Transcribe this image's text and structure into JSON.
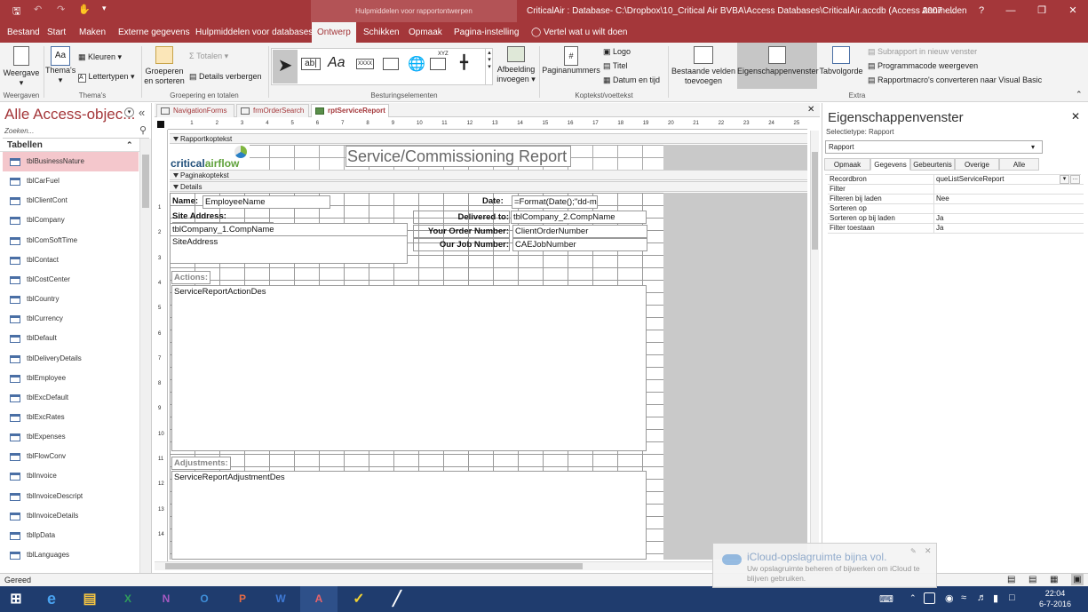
{
  "titlebar": {
    "context_tab": "Hulpmiddelen voor rapportontwerpen",
    "title": "CriticalAir : Database- C:\\Dropbox\\10_Critical Air BVBA\\Access Databases\\CriticalAir.accdb (Access 2007 -...",
    "signin": "Aanmelden",
    "help": "?"
  },
  "tabs": [
    "Bestand",
    "Start",
    "Maken",
    "Externe gegevens",
    "Hulpmiddelen voor databases",
    "Ontwerp",
    "Schikken",
    "Opmaak",
    "Pagina-instelling"
  ],
  "tell_me": "Vertel wat u wilt doen",
  "ribbon": {
    "weergave": "Weergave",
    "themas": "Thema's",
    "kleuren": "Kleuren",
    "lettertypen": "Lettertypen",
    "groeperen": "Groeperen en sorteren",
    "totalen": "Totalen",
    "details_verbergen": "Details verbergen",
    "afbeelding": "Afbeelding invoegen",
    "paginanummers": "Paginanummers",
    "logo": "Logo",
    "titel": "Titel",
    "datum_tijd": "Datum en tijd",
    "bestaande_velden": "Bestaande velden toevoegen",
    "eigenschappenvenster": "Eigenschappenvenster",
    "tabvolgorde": "Tabvolgorde",
    "subrapport": "Subrapport in nieuw venster",
    "programmacode": "Programmacode weergeven",
    "macros_converteren": "Rapportmacro's converteren naar Visual Basic",
    "groups": {
      "weergaven": "Weergaven",
      "themas": "Thema's",
      "groepering": "Groepering en totalen",
      "besturing": "Besturingselementen",
      "koptekst": "Koptekst/voettekst",
      "extra": "Extra"
    }
  },
  "nav": {
    "header": "Alle Access-objec...",
    "search_placeholder": "Zoeken...",
    "section": "Tabellen",
    "items": [
      "tblBusinessNature",
      "tblCarFuel",
      "tblClientCont",
      "tblCompany",
      "tblComSoftTime",
      "tblContact",
      "tblCostCenter",
      "tblCountry",
      "tblCurrency",
      "tblDefault",
      "tblDeliveryDetails",
      "tblEmployee",
      "tblExcDefault",
      "tblExcRates",
      "tblExpenses",
      "tblFlowConv",
      "tblInvoice",
      "tblInvoiceDescript",
      "tblInvoiceDetails",
      "tblIpData",
      "tblLanguages"
    ],
    "selected_index": 0
  },
  "doc_tabs": [
    "NavigationForms",
    "frmOrderSearch",
    "rptServiceReport"
  ],
  "report": {
    "band_header": "Rapportkoptekst",
    "band_page": "Paginakoptekst",
    "band_details": "Details",
    "title": "Service/Commissioning Report",
    "logo_text_1": "critical",
    "logo_text_2": "airflow",
    "name_label": "Name:",
    "name_field": "EmployeeName",
    "date_label": "Date:",
    "date_field": "=Format(Date();\"dd-m",
    "site_label": "Site Address:",
    "site_company": "tblCompany_1.CompName",
    "site_address": "SiteAddress",
    "delivered_label": "Delivered to:",
    "delivered_field": "tblCompany_2.CompName",
    "order_label": "Your Order Number:",
    "order_field": "ClientOrderNumber",
    "job_label": "Our Job Number:",
    "job_field": "CAEJobNumber",
    "actions_label": "Actions:",
    "actions_field": "ServiceReportActionDes",
    "adjust_label": "Adjustments:",
    "adjust_field": "ServiceReportAdjustmentDes"
  },
  "props": {
    "header": "Eigenschappenvenster",
    "selection": "Selectietype:  Rapport",
    "object": "Rapport",
    "tabs": [
      "Opmaak",
      "Gegevens",
      "Gebeurtenis",
      "Overige",
      "Alle"
    ],
    "rows": [
      {
        "k": "Recordbron",
        "v": "queListServiceReport"
      },
      {
        "k": "Filter",
        "v": ""
      },
      {
        "k": "Filteren bij laden",
        "v": "Nee"
      },
      {
        "k": "Sorteren op",
        "v": ""
      },
      {
        "k": "Sorteren op bij laden",
        "v": "Ja"
      },
      {
        "k": "Filter toestaan",
        "v": "Ja"
      }
    ]
  },
  "status": "Gereed",
  "toast": {
    "title": "iCloud-opslagruimte bijna vol.",
    "body": "Uw opslagruimte beheren of bijwerken om iCloud te blijven gebruiken."
  },
  "clock": {
    "time": "22:04",
    "date": "6-7-2016"
  },
  "colors": {
    "accent": "#a4373a",
    "selected_nav": "#f4c7cc",
    "taskbar": "#1f3c6e"
  }
}
